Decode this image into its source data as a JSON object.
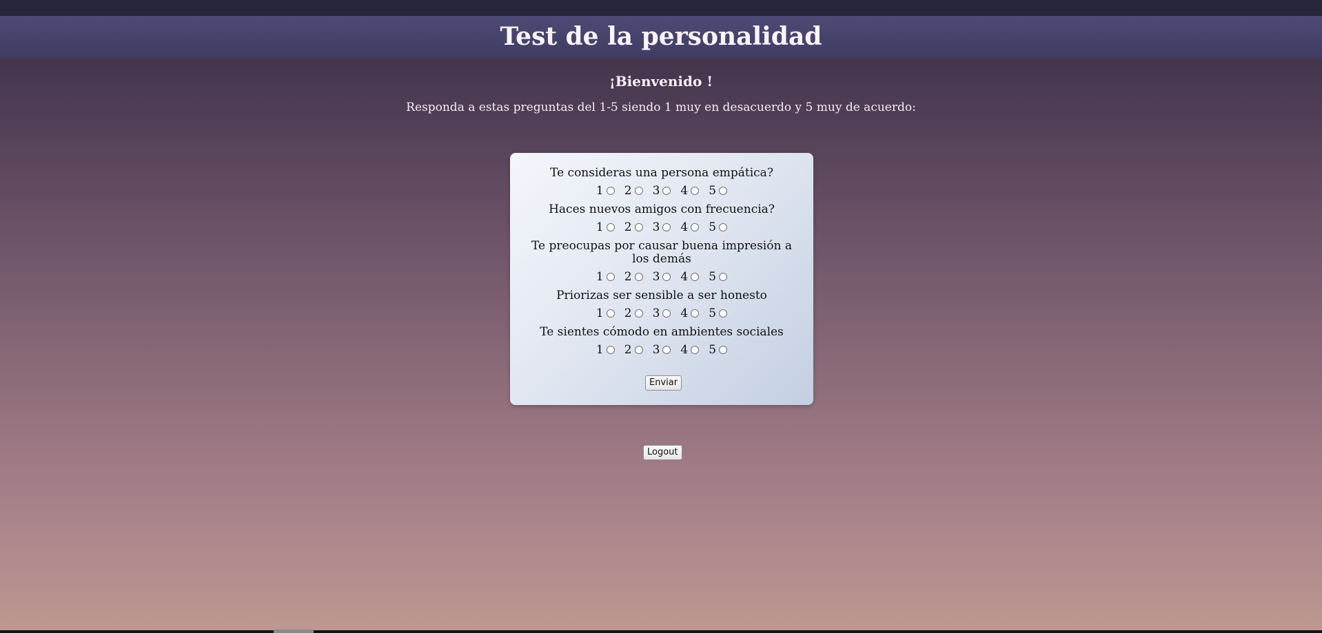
{
  "header": {
    "title": "Test de la personalidad"
  },
  "welcome": "¡Bienvenido !",
  "instructions": "Responda a estas preguntas del 1-5 siendo 1 muy en desacuerdo y 5 muy de acuerdo:",
  "scale_labels": [
    "1",
    "2",
    "3",
    "4",
    "5"
  ],
  "questions": [
    {
      "text": "Te consideras una persona empática?"
    },
    {
      "text": "Haces nuevos amigos con frecuencia?"
    },
    {
      "text": "Te preocupas por causar buena impresión a los demás"
    },
    {
      "text": "Priorizas ser sensible a ser honesto"
    },
    {
      "text": "Te sientes cómodo en ambientes sociales"
    }
  ],
  "form": {
    "submit_label": "Enviar"
  },
  "logout_label": "Logout"
}
